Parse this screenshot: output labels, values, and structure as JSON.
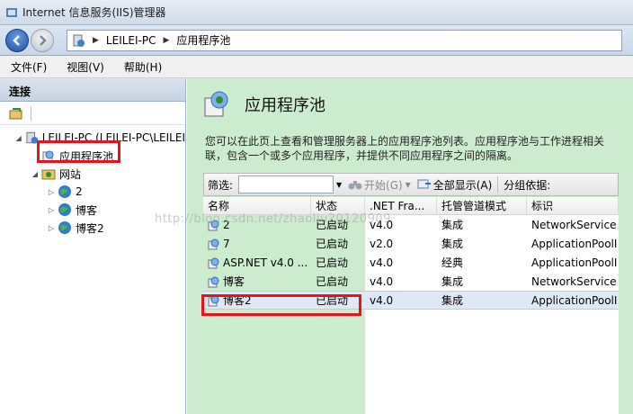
{
  "window": {
    "title": "Internet 信息服务(IIS)管理器"
  },
  "address": {
    "crumbs": [
      "LEILEI-PC",
      "应用程序池"
    ]
  },
  "menu": {
    "items": [
      "文件(F)",
      "视图(V)",
      "帮助(H)"
    ]
  },
  "left": {
    "header": "连接",
    "tree": {
      "server": "LEILEI-PC (LEILEI-PC\\LEILEI",
      "app_pools": "应用程序池",
      "sites": "网站",
      "site_items": [
        "2",
        "博客",
        "博客2"
      ]
    }
  },
  "right": {
    "title": "应用程序池",
    "description": "您可以在此页上查看和管理服务器上的应用程序池列表。应用程序池与工作进程相关联，包含一个或多个应用程序，并提供不同应用程序之间的隔离。",
    "filter": {
      "label": "筛选:",
      "start": "开始(G)",
      "show_all": "全部显示(A)",
      "group_by": "分组依据:"
    },
    "columns": [
      "名称",
      "状态",
      ".NET Fra...",
      "托管管道模式",
      "标识"
    ],
    "rows": [
      {
        "name": "2",
        "status": "已启动",
        "net": "v4.0",
        "mode": "集成",
        "identity": "NetworkService"
      },
      {
        "name": "7",
        "status": "已启动",
        "net": "v2.0",
        "mode": "集成",
        "identity": "ApplicationPoolI"
      },
      {
        "name": "ASP.NET v4.0 ...",
        "status": "已启动",
        "net": "v4.0",
        "mode": "经典",
        "identity": "ApplicationPoolI"
      },
      {
        "name": "博客",
        "status": "已启动",
        "net": "v4.0",
        "mode": "集成",
        "identity": "NetworkService"
      },
      {
        "name": "博客2",
        "status": "已启动",
        "net": "v4.0",
        "mode": "集成",
        "identity": "ApplicationPoolI"
      }
    ]
  },
  "watermark": "http://blog.csdn.net/zhaoliu20120909",
  "colors": {
    "highlight": "#e4141c",
    "content_bg": "#cdeccf",
    "selected_row": "#dfe9f5"
  }
}
